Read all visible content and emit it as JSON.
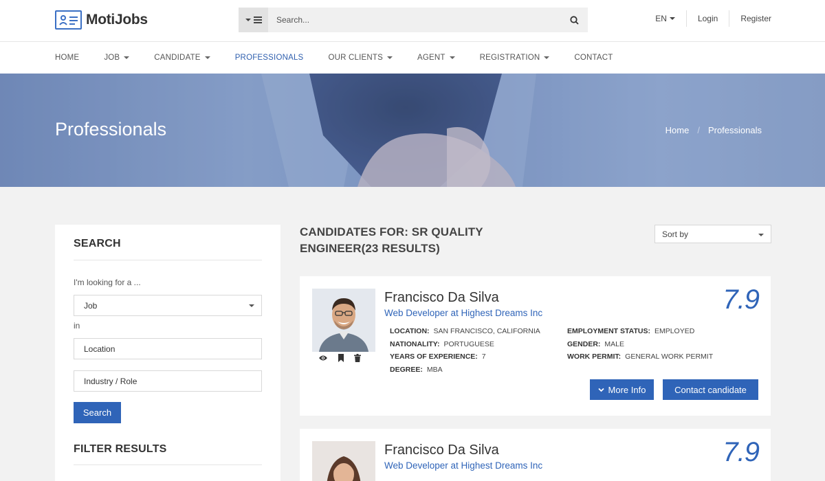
{
  "brand": {
    "name": "MotiJobs"
  },
  "header": {
    "search_placeholder": "Search...",
    "lang": "EN",
    "login": "Login",
    "register": "Register"
  },
  "nav": {
    "items": [
      {
        "label": "HOME",
        "dropdown": false
      },
      {
        "label": "JOB",
        "dropdown": true
      },
      {
        "label": "CANDIDATE",
        "dropdown": true
      },
      {
        "label": "PROFESSIONALS",
        "dropdown": false,
        "active": true
      },
      {
        "label": "OUR CLIENTS",
        "dropdown": true
      },
      {
        "label": "AGENT",
        "dropdown": true
      },
      {
        "label": "REGISTRATION",
        "dropdown": true
      },
      {
        "label": "CONTACT",
        "dropdown": false
      }
    ]
  },
  "banner": {
    "title": "Professionals",
    "breadcrumb": [
      "Home",
      "Professionals"
    ]
  },
  "sidebar": {
    "search_heading": "SEARCH",
    "looking_label": "I'm looking for a ...",
    "type_value": "Job",
    "in_label": "in",
    "location_placeholder": "Location",
    "industry_placeholder": "Industry / Role",
    "search_button": "Search",
    "filter_heading": "FILTER RESULTS"
  },
  "results": {
    "heading": "CANDIDATES FOR: SR QUALITY ENGINEER(23 RESULTS)",
    "sort_label": "Sort by"
  },
  "candidates": [
    {
      "name": "Francisco Da Silva",
      "role": "Web Developer at Highest Dreams Inc",
      "score": "7.9",
      "location_label": "LOCATION:",
      "location": "SAN FRANCISCO, CALIFORNIA",
      "nationality_label": "NATIONALITY:",
      "nationality": "PORTUGUESE",
      "experience_label": "YEARS OF EXPERIENCE:",
      "experience": "7",
      "degree_label": "DEGREE:",
      "degree": "MBA",
      "employment_label": "EMPLOYMENT STATUS:",
      "employment": "EMPLOYED",
      "gender_label": "GENDER:",
      "gender": "MALE",
      "permit_label": "WORK PERMIT:",
      "permit": "GENERAL WORK PERMIT",
      "more_info": "More Info",
      "contact": "Contact candidate"
    },
    {
      "name": "Francisco Da Silva",
      "role": "Web Developer at Highest Dreams Inc",
      "score": "7.9"
    }
  ],
  "colors": {
    "accent": "#2f64b8",
    "banner": "#7b93bf"
  }
}
